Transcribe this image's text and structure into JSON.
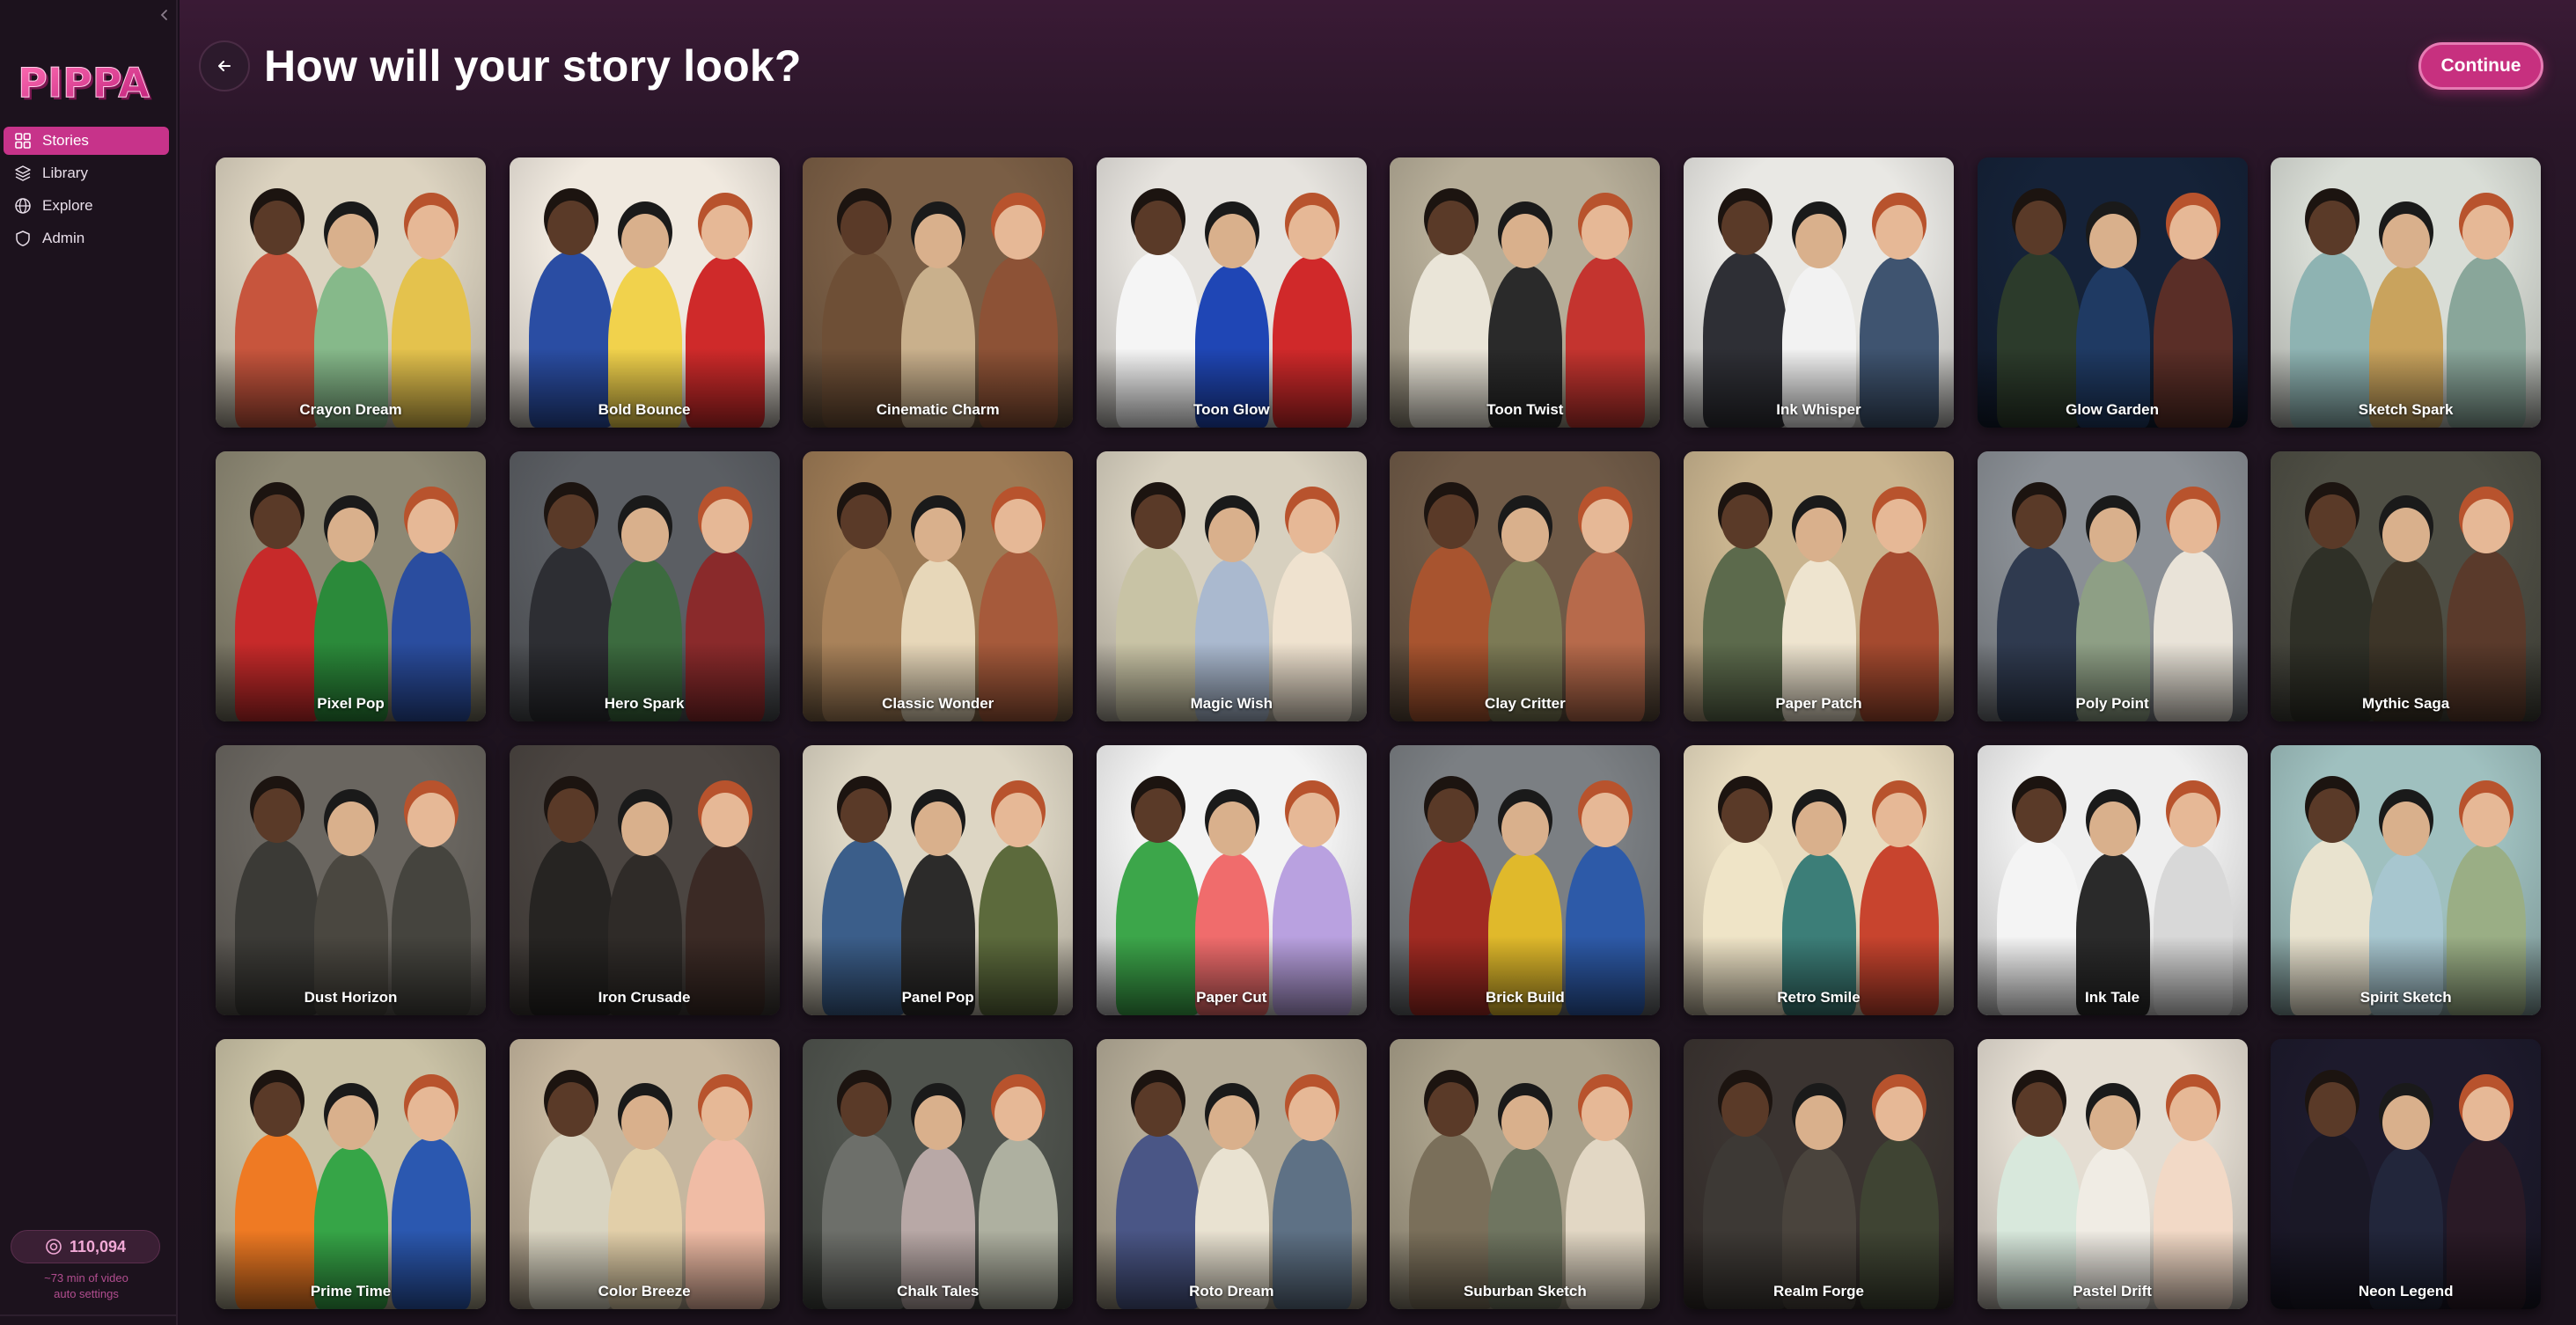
{
  "app": {
    "logo_text": "PIPPA",
    "collapse_icon": "chevron-left-icon"
  },
  "sidebar": {
    "items": [
      {
        "label": "Stories",
        "icon": "grid-icon",
        "active": true
      },
      {
        "label": "Library",
        "icon": "layers-icon",
        "active": false
      },
      {
        "label": "Explore",
        "icon": "globe-icon",
        "active": false
      },
      {
        "label": "Admin",
        "icon": "shield-icon",
        "active": false
      }
    ],
    "credits": {
      "value": "110,094",
      "icon": "coin-icon",
      "note_line1": "~73 min of video",
      "note_line2": "auto settings"
    }
  },
  "header": {
    "title": "How will your story look?",
    "back_icon": "arrow-left-icon",
    "continue_label": "Continue"
  },
  "colors": {
    "accent": "#c7307f",
    "nav_active": "#c7338a",
    "background": "#1b121c"
  },
  "styles": [
    {
      "name": "Crayon Dream",
      "bg": "#dcd3c0",
      "tones": [
        "#c7553d",
        "#86b98a",
        "#e4c24d"
      ]
    },
    {
      "name": "Bold Bounce",
      "bg": "#f0e9df",
      "tones": [
        "#2a4da3",
        "#f1d24c",
        "#cf2a2a"
      ]
    },
    {
      "name": "Cinematic Charm",
      "bg": "#7a5e45",
      "tones": [
        "#6e4f36",
        "#c9b08c",
        "#8d5236"
      ]
    },
    {
      "name": "Toon Glow",
      "bg": "#e6e3de",
      "tones": [
        "#f5f5f5",
        "#1f46b5",
        "#d0292a"
      ]
    },
    {
      "name": "Toon Twist",
      "bg": "#b6ad98",
      "tones": [
        "#eae5d8",
        "#2a2a2a",
        "#c4342f"
      ]
    },
    {
      "name": "Ink Whisper",
      "bg": "#e9e8e4",
      "tones": [
        "#2e2f35",
        "#f2f2f2",
        "#3f5470"
      ]
    },
    {
      "name": "Glow Garden",
      "bg": "#152238",
      "tones": [
        "#2c3b2b",
        "#1f3a63",
        "#5a2e27"
      ]
    },
    {
      "name": "Sketch Spark",
      "bg": "#d9ddd6",
      "tones": [
        "#8eb3b2",
        "#c9a35d",
        "#89a69a"
      ]
    },
    {
      "name": "Pixel Pop",
      "bg": "#8d8874",
      "tones": [
        "#c72a2a",
        "#2b8a3a",
        "#2a4d9f"
      ]
    },
    {
      "name": "Hero Spark",
      "bg": "#5b5e63",
      "tones": [
        "#2d2e33",
        "#3c6b3f",
        "#8a2a2b"
      ]
    },
    {
      "name": "Classic Wonder",
      "bg": "#9c7a55",
      "tones": [
        "#a9825a",
        "#e7d7b9",
        "#a65a3b"
      ]
    },
    {
      "name": "Magic Wish",
      "bg": "#d7d0bf",
      "tones": [
        "#c8c3a5",
        "#aab9cf",
        "#efe2cf"
      ]
    },
    {
      "name": "Clay Critter",
      "bg": "#6f5a47",
      "tones": [
        "#a8542f",
        "#7c7a55",
        "#b76a4b"
      ]
    },
    {
      "name": "Paper Patch",
      "bg": "#c9b48f",
      "tones": [
        "#5c6a4c",
        "#eee4cf",
        "#a54a2f"
      ]
    },
    {
      "name": "Poly Point",
      "bg": "#8a8f95",
      "tones": [
        "#2f3a4f",
        "#8e9f85",
        "#e9e3d8"
      ]
    },
    {
      "name": "Mythic Saga",
      "bg": "#4e4e44",
      "tones": [
        "#2f3027",
        "#3d3528",
        "#5a3a2b"
      ]
    },
    {
      "name": "Dust Horizon",
      "bg": "#6a6660",
      "tones": [
        "#3b3a36",
        "#4a4740",
        "#45443e"
      ]
    },
    {
      "name": "Iron Crusade",
      "bg": "#4b4541",
      "tones": [
        "#262422",
        "#2f2b28",
        "#3b2a25"
      ]
    },
    {
      "name": "Panel Pop",
      "bg": "#ddd6c4",
      "tones": [
        "#3b5e8a",
        "#2c2b2a",
        "#5c6a3c"
      ]
    },
    {
      "name": "Paper Cut",
      "bg": "#f3f3f3",
      "tones": [
        "#3ca64a",
        "#f06c6c",
        "#b9a1e0"
      ]
    },
    {
      "name": "Brick Build",
      "bg": "#7b7f83",
      "tones": [
        "#a12a22",
        "#e0b92b",
        "#2d5aa8"
      ]
    },
    {
      "name": "Retro Smile",
      "bg": "#e8dcc0",
      "tones": [
        "#efe4c7",
        "#3c7e78",
        "#c8442e"
      ]
    },
    {
      "name": "Ink Tale",
      "bg": "#efefef",
      "tones": [
        "#f4f4f4",
        "#2a2a2a",
        "#d8d8d8"
      ]
    },
    {
      "name": "Spirit Sketch",
      "bg": "#9fc0bf",
      "tones": [
        "#e9e3cf",
        "#a7c6cf",
        "#9aae85"
      ]
    },
    {
      "name": "Prime Time",
      "bg": "#c9c1a5",
      "tones": [
        "#ef7a23",
        "#36a547",
        "#2b58b0"
      ]
    },
    {
      "name": "Color Breeze",
      "bg": "#c6b79f",
      "tones": [
        "#d9d4c1",
        "#e2cfa9",
        "#f0bca5"
      ]
    },
    {
      "name": "Chalk Tales",
      "bg": "#4f534d",
      "tones": [
        "#6d6f6a",
        "#b8a8a6",
        "#aeb0a0"
      ]
    },
    {
      "name": "Roto Dream",
      "bg": "#b4ab97",
      "tones": [
        "#4a5686",
        "#e9e2d1",
        "#5e7185"
      ]
    },
    {
      "name": "Suburban Sketch",
      "bg": "#a9a08a",
      "tones": [
        "#7a6f5a",
        "#6f7560",
        "#e2d7c4"
      ]
    },
    {
      "name": "Realm Forge",
      "bg": "#3b3431",
      "tones": [
        "#3d3935",
        "#4a443d",
        "#3f4433"
      ]
    },
    {
      "name": "Pastel Drift",
      "bg": "#e4ddd2",
      "tones": [
        "#d8e8dc",
        "#f0ece4",
        "#f2d9c6"
      ]
    },
    {
      "name": "Neon Legend",
      "bg": "#1d1a2c",
      "tones": [
        "#1a1826",
        "#22263b",
        "#2a1a26"
      ]
    }
  ]
}
